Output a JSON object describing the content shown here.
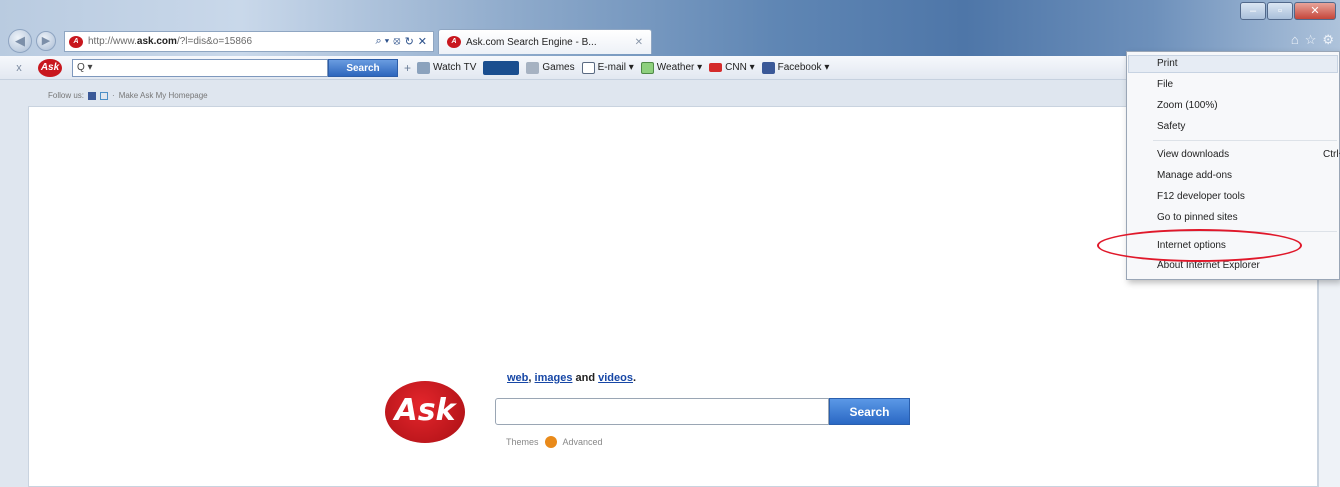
{
  "browser": {
    "address": {
      "url_prefix": "http://www.",
      "url_domain": "ask.com",
      "url_suffix": "/?l=dis&o=15866",
      "tools": [
        "⌕ ▾",
        "⦻",
        "↻",
        "✕"
      ]
    },
    "tab": {
      "title": "Ask.com Search Engine - B...",
      "close": "✕"
    }
  },
  "toolbar": {
    "close": "x",
    "logo": "Ask",
    "search_value": "Q ▾",
    "search_button": "Search",
    "add": "+",
    "items": [
      {
        "label": "Watch TV",
        "icon": "tv-icon"
      },
      {
        "label": "",
        "icon": "radio-icon"
      },
      {
        "label": "Games",
        "icon": "games-icon"
      },
      {
        "label": "E-mail ▾",
        "icon": "mail-icon"
      },
      {
        "label": "Weather ▾",
        "icon": "weather-icon"
      },
      {
        "label": "CNN ▾",
        "icon": "cnn-icon"
      },
      {
        "label": "Facebook ▾",
        "icon": "facebook-icon"
      }
    ]
  },
  "page": {
    "follow_label": "Follow us:",
    "make_homepage": "Make Ask My Homepage",
    "logo": "Ask",
    "links": {
      "web": "web",
      "images": "images",
      "and": " and ",
      "videos": "videos"
    },
    "search_button": "Search",
    "themes": "Themes",
    "advanced": "Advanced"
  },
  "menu": {
    "items": [
      {
        "label": "Print",
        "shortcut": ""
      },
      {
        "label": "File",
        "shortcut": ""
      },
      {
        "label": "Zoom (100%)",
        "shortcut": ""
      },
      {
        "label": "Safety",
        "shortcut": ""
      },
      {
        "label": "View downloads",
        "shortcut": "Ctrl+J"
      },
      {
        "label": "Manage add-ons",
        "shortcut": ""
      },
      {
        "label": "F12 developer tools",
        "shortcut": ""
      },
      {
        "label": "Go to pinned sites",
        "shortcut": ""
      },
      {
        "label": "Internet options",
        "shortcut": ""
      },
      {
        "label": "About Internet Explorer",
        "shortcut": ""
      }
    ]
  },
  "colors": {
    "ask_red": "#c8171e",
    "search_blue": "#2a68c4",
    "annotation_ring": "#e0182a"
  }
}
